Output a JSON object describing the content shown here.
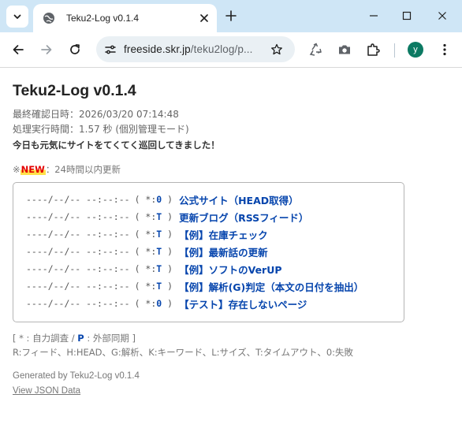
{
  "browser": {
    "tab_title": "Teku2-Log v0.1.4",
    "url_host": "freeside.skr.jp",
    "url_path": "/teku2log/p...",
    "avatar_letter": "y"
  },
  "page": {
    "title": "Teku2-Log v0.1.4",
    "last_checked": "最終確認日時：2026/03/20 07:14:48",
    "processing_time": "処理実行時間：1.57 秒 (個別管理モード)",
    "greeting": "今日も元気にサイトをてくてく巡回してきました！",
    "new_note_prefix": "※",
    "new_badge": "NEW",
    "new_note_suffix": "：24時間以内更新",
    "sites": [
      {
        "date": "----/--/-- --:--:--",
        "sync_open": "( *:",
        "sync_code": "0",
        "sync_close": ")",
        "label": "公式サイト（HEAD取得）"
      },
      {
        "date": "----/--/-- --:--:--",
        "sync_open": "( *:",
        "sync_code": "T",
        "sync_close": ")",
        "label": "更新ブログ（RSSフィード）"
      },
      {
        "date": "----/--/-- --:--:--",
        "sync_open": "( *:",
        "sync_code": "T",
        "sync_close": ")",
        "label": "【例】在庫チェック"
      },
      {
        "date": "----/--/-- --:--:--",
        "sync_open": "( *:",
        "sync_code": "T",
        "sync_close": ")",
        "label": "【例】最新話の更新"
      },
      {
        "date": "----/--/-- --:--:--",
        "sync_open": "( *:",
        "sync_code": "T",
        "sync_close": ")",
        "label": "【例】ソフトのVerUP"
      },
      {
        "date": "----/--/-- --:--:--",
        "sync_open": "( *:",
        "sync_code": "T",
        "sync_close": ")",
        "label": "【例】解析(G)判定（本文の日付を抽出）"
      },
      {
        "date": "----/--/-- --:--:--",
        "sync_open": "( *:",
        "sync_code": "0",
        "sync_close": ")",
        "label": "【テスト】存在しないページ"
      }
    ],
    "legend_line1_a": "[ * : 自力調査 / ",
    "legend_line1_key": "P",
    "legend_line1_b": " : 外部同期 ]",
    "legend_line2": "R:フィード、H:HEAD、G:解析、K:キーワード、L:サイズ、T:タイムアウト、0:失敗",
    "generated_by": "Generated by Teku2-Log v0.1.4",
    "json_link": "View JSON Data"
  },
  "colors": {
    "link": "#0645ad",
    "new_badge": "#e40000",
    "new_highlight": "#ffe14a",
    "tab_strip": "#cfe6f6",
    "avatar": "#0c7a63"
  },
  "icons": [
    "tab-search-icon",
    "globe-icon",
    "close-icon",
    "plus-icon",
    "minimize-icon",
    "maximize-icon",
    "back-icon",
    "forward-icon",
    "reload-icon",
    "site-info-icon",
    "star-icon",
    "recycle-extension-icon",
    "camera-icon",
    "extensions-icon"
  ]
}
